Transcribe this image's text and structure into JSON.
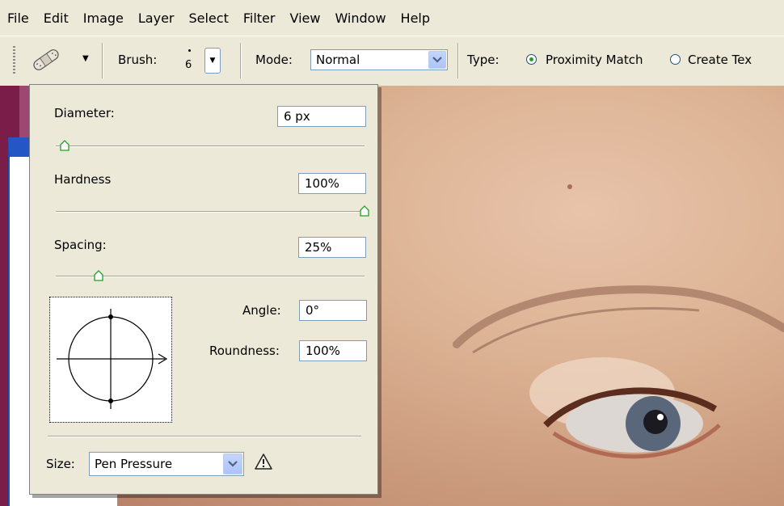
{
  "menubar": {
    "items": [
      "File",
      "Edit",
      "Image",
      "Layer",
      "Select",
      "Filter",
      "View",
      "Window",
      "Help"
    ]
  },
  "options": {
    "tool_icon": "bandage-brush-icon",
    "brush_label": "Brush:",
    "brush_size": "6",
    "mode_label": "Mode:",
    "mode_value": "Normal",
    "type_label": "Type:",
    "type_option1": "Proximity Match",
    "type_option2": "Create Tex",
    "type_selected": "Proximity Match"
  },
  "brush_panel": {
    "diameter_label": "Diameter:",
    "diameter_value": "6 px",
    "hardness_label": "Hardness",
    "hardness_value": "100%",
    "spacing_label": "Spacing:",
    "spacing_value": "25%",
    "angle_label": "Angle:",
    "angle_value": "0°",
    "roundness_label": "Roundness:",
    "roundness_value": "100%",
    "size_label": "Size:",
    "size_value": "Pen Pressure",
    "warning_icon": "warning-triangle-icon",
    "slider_levels": {
      "diameter": 0.02,
      "hardness": 1.0,
      "spacing": 0.13
    }
  },
  "colors": {
    "menubar_bg": "#ece9d8",
    "select_border": "#7f9db9",
    "titlebar_blue": "#2556c5"
  }
}
